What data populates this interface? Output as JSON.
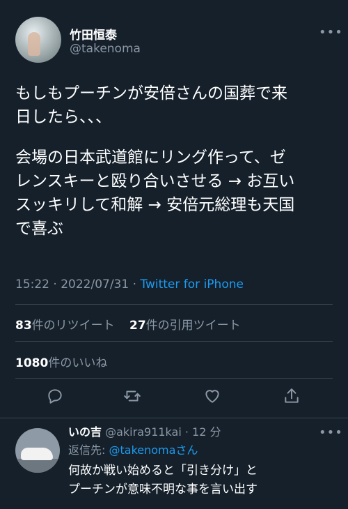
{
  "author": {
    "name": "竹田恒泰",
    "handle": "@takenoma"
  },
  "tweet": {
    "paragraph1": "もしもプーチンが安倍さんの国葬で来\n日したら、、、",
    "paragraph2": "会場の日本武道館にリング作って、ゼ\nレンスキーと殴り合いさせる → お互い\nスッキリして和解 → 安倍元総理も天国\nで喜ぶ",
    "time": "15:22 · 2022/07/31 · ",
    "source": "Twitter for iPhone"
  },
  "stats": {
    "retweets_count": "83",
    "retweets_label": "件のリツイート",
    "quotes_count": "27",
    "quotes_label": "件の引用ツイート",
    "likes_count": "1080",
    "likes_label": "件のいいね"
  },
  "actions": [
    "reply-icon",
    "retweet-icon",
    "like-icon",
    "share-icon"
  ],
  "reply": {
    "name": "いの吉",
    "handle": "@akira911kai",
    "time": "· 12 分",
    "replying_prefix": "返信先: ",
    "replying_to": "@takenoma",
    "replying_suffix": "さん",
    "text_line1": "何故か戦い始めると「引き分け」と",
    "text_line2": "プーチンが意味不明な事を言い出す"
  },
  "more_icon": "•••",
  "colors": {
    "background": "#15202b",
    "accent": "#1d9bf0",
    "muted": "#8b98a5",
    "divider": "#38444d"
  }
}
